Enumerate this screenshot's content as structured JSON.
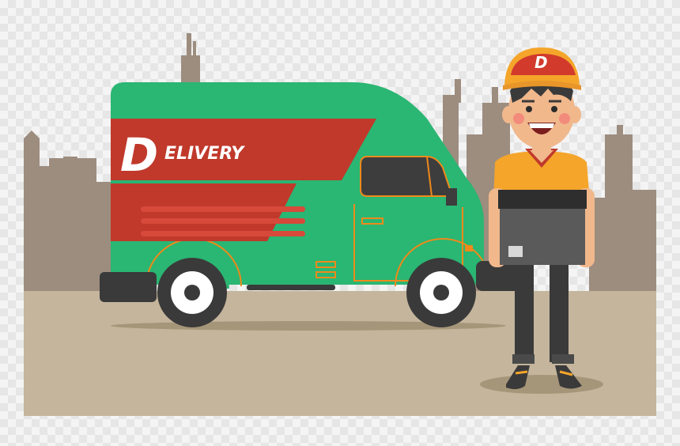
{
  "illustration": {
    "brand_initial": "D",
    "brand_rest": "ELIVERY",
    "cap_logo": "D"
  },
  "colors": {
    "ground": "#c4b59c",
    "city": "#9d8d7f",
    "van_green": "#2ab673",
    "van_red": "#c0392b",
    "van_stripe": "#d7493a",
    "cap_red": "#d23a2c",
    "shirt_orange": "#f4a52a",
    "box_gray": "#5a5a5a",
    "tire": "#3a3a3a"
  }
}
